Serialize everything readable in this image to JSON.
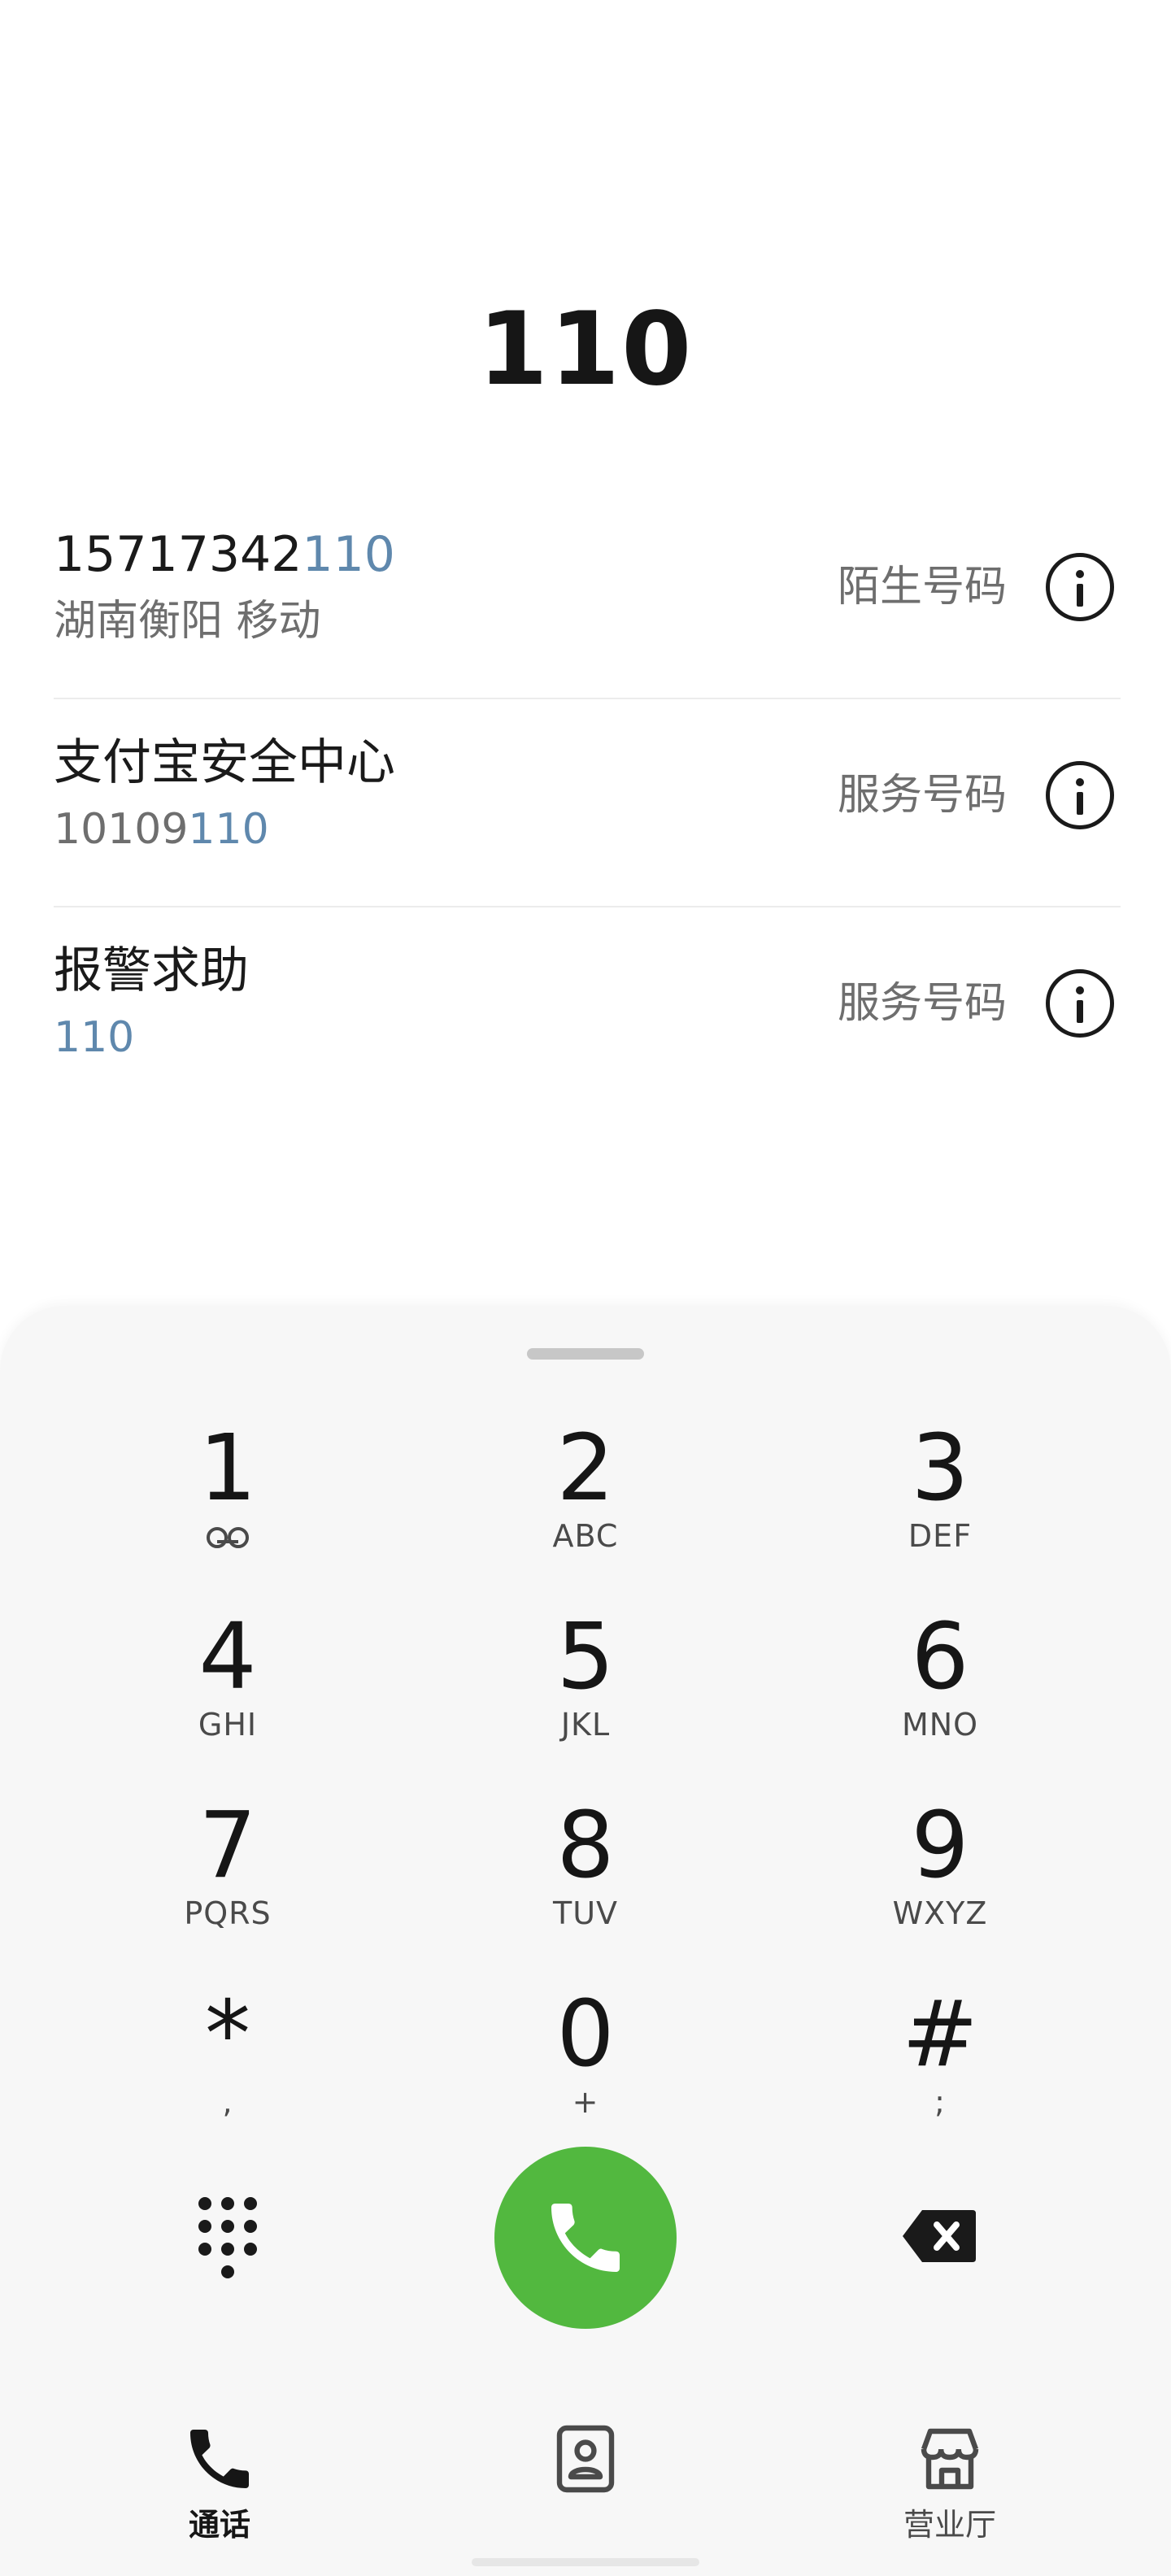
{
  "dialed_number": "110",
  "results": [
    {
      "title_plain": "15717342",
      "title_match": "110",
      "sub_plain": "湖南衡阳 移动",
      "sub_match": "",
      "type": "陌生号码"
    },
    {
      "title_plain": "支付宝安全中心",
      "title_match": "",
      "sub_plain": "10109",
      "sub_match": "110",
      "type": "服务号码"
    },
    {
      "title_plain": "报警求助",
      "title_match": "",
      "sub_plain": "",
      "sub_match": "110",
      "type": "服务号码"
    }
  ],
  "keypad": [
    {
      "digit": "1",
      "letters": "",
      "icon": "voicemail-icon"
    },
    {
      "digit": "2",
      "letters": "ABC"
    },
    {
      "digit": "3",
      "letters": "DEF"
    },
    {
      "digit": "4",
      "letters": "GHI"
    },
    {
      "digit": "5",
      "letters": "JKL"
    },
    {
      "digit": "6",
      "letters": "MNO"
    },
    {
      "digit": "7",
      "letters": "PQRS"
    },
    {
      "digit": "8",
      "letters": "TUV"
    },
    {
      "digit": "9",
      "letters": "WXYZ"
    },
    {
      "digit": "*",
      "letters": ","
    },
    {
      "digit": "0",
      "letters": "+"
    },
    {
      "digit": "#",
      "letters": ";"
    }
  ],
  "actions": {
    "dialpad_icon": "dialpad-icon",
    "call_icon": "phone-icon",
    "backspace_icon": "backspace-icon"
  },
  "nav": [
    {
      "label": "通话",
      "icon": "phone-icon",
      "active": true
    },
    {
      "label": "",
      "icon": "contacts-icon",
      "active": false
    },
    {
      "label": "营业厅",
      "icon": "store-icon",
      "active": false
    }
  ],
  "colors": {
    "match_highlight": "#5f88ad",
    "call_button": "#52b83f",
    "sheet_bg": "#f7f7f7"
  }
}
